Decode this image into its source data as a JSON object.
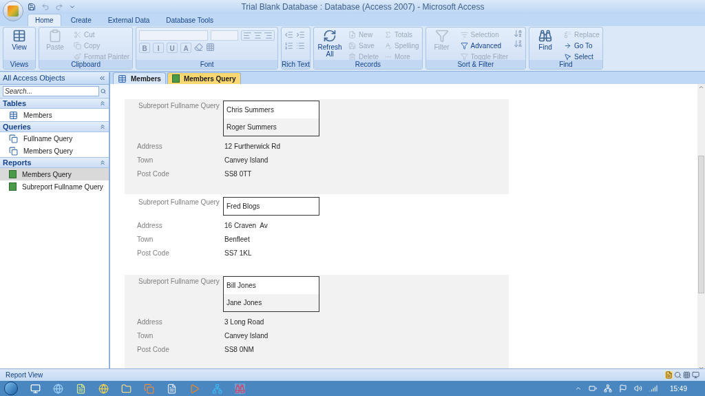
{
  "window": {
    "title": "Trial Blank Database : Database (Access 2007) - Microsoft Access"
  },
  "ribbon_tabs": [
    {
      "label": "Home",
      "selected": true
    },
    {
      "label": "Create",
      "selected": false
    },
    {
      "label": "External Data",
      "selected": false
    },
    {
      "label": "Database Tools",
      "selected": false
    }
  ],
  "ribbon_groups": [
    {
      "label": "Views",
      "items": [
        {
          "label": "View",
          "kind": "large",
          "disabled": false
        }
      ]
    },
    {
      "label": "Clipboard",
      "items": [
        {
          "label": "Paste",
          "kind": "large",
          "disabled": true
        },
        {
          "label": "Cut",
          "kind": "small",
          "disabled": true
        },
        {
          "label": "Copy",
          "kind": "small",
          "disabled": true
        },
        {
          "label": "Format Painter",
          "kind": "small",
          "disabled": true
        }
      ]
    },
    {
      "label": "Font",
      "items": [
        {
          "label": "B",
          "kind": "format",
          "disabled": true
        },
        {
          "label": "I",
          "kind": "format",
          "disabled": true
        },
        {
          "label": "U",
          "kind": "format",
          "disabled": true
        },
        {
          "label": "A",
          "kind": "format",
          "disabled": true
        }
      ]
    },
    {
      "label": "Rich Text"
    },
    {
      "label": "Records",
      "items": [
        {
          "label": "Refresh All",
          "kind": "large",
          "disabled": false
        },
        {
          "label": "New",
          "kind": "small",
          "disabled": true
        },
        {
          "label": "Save",
          "kind": "small",
          "disabled": true
        },
        {
          "label": "Delete",
          "kind": "small",
          "disabled": true
        },
        {
          "label": "Totals",
          "kind": "small",
          "disabled": true
        },
        {
          "label": "Spelling",
          "kind": "small",
          "disabled": true
        },
        {
          "label": "More",
          "kind": "small",
          "disabled": true
        }
      ]
    },
    {
      "label": "Sort & Filter",
      "items": [
        {
          "label": "Filter",
          "kind": "large",
          "disabled": true
        },
        {
          "label": "Selection",
          "kind": "small",
          "disabled": true
        },
        {
          "label": "Advanced",
          "kind": "small",
          "disabled": false
        },
        {
          "label": "Toggle Filter",
          "kind": "small",
          "disabled": true
        }
      ]
    },
    {
      "label": "Find",
      "items": [
        {
          "label": "Find",
          "kind": "large",
          "disabled": false
        },
        {
          "label": "Replace",
          "kind": "small",
          "disabled": true
        },
        {
          "label": "Go To",
          "kind": "small",
          "disabled": false
        },
        {
          "label": "Select",
          "kind": "small",
          "disabled": false
        }
      ]
    }
  ],
  "navigation_pane": {
    "title": "All Access Objects",
    "search": {
      "placeholder": "Search..."
    },
    "groups": [
      {
        "label": "Tables",
        "expanded": true,
        "items": [
          {
            "label": "Members",
            "kind": "table",
            "selected": false
          }
        ]
      },
      {
        "label": "Queries",
        "expanded": true,
        "items": [
          {
            "label": "Fullname Query",
            "kind": "query",
            "selected": false
          },
          {
            "label": "Members Query",
            "kind": "query",
            "selected": false
          }
        ]
      },
      {
        "label": "Reports",
        "expanded": true,
        "items": [
          {
            "label": "Members Query",
            "kind": "report",
            "selected": true
          },
          {
            "label": "Subreport Fullname Query",
            "kind": "report",
            "selected": false
          }
        ]
      }
    ]
  },
  "document_tabs": [
    {
      "label": "Members",
      "kind": "table",
      "selected": false
    },
    {
      "label": "Members Query",
      "kind": "report",
      "selected": true
    }
  ],
  "report": {
    "records": [
      {
        "shaded": true,
        "subreport_label": "Subreport Fullname Query",
        "names": [
          "Chris Summers",
          "Roger Summers"
        ],
        "fields": [
          {
            "label": "Address",
            "value": "12 Furtherwick Rd"
          },
          {
            "label": "Town",
            "value": "Canvey Island"
          },
          {
            "label": "Post Code",
            "value": "SS8 0TT"
          }
        ]
      },
      {
        "shaded": false,
        "subreport_label": "Subreport Fullname Query",
        "names": [
          "Fred Blogs"
        ],
        "fields": [
          {
            "label": "Address",
            "value": "16 Craven  Av"
          },
          {
            "label": "Town",
            "value": "Benfleet"
          },
          {
            "label": "Post Code",
            "value": "SS7 1KL"
          }
        ]
      },
      {
        "shaded": true,
        "subreport_label": "Subreport Fullname Query",
        "names": [
          "Bill Jones",
          "Jane Jones"
        ],
        "fields": [
          {
            "label": "Address",
            "value": "3 Long Road"
          },
          {
            "label": "Town",
            "value": "Canvey Island"
          },
          {
            "label": "Post Code",
            "value": "SS8 0NM"
          }
        ]
      }
    ]
  },
  "status_bar": {
    "text": "Report View"
  },
  "taskbar": {
    "clock": "15:49"
  }
}
